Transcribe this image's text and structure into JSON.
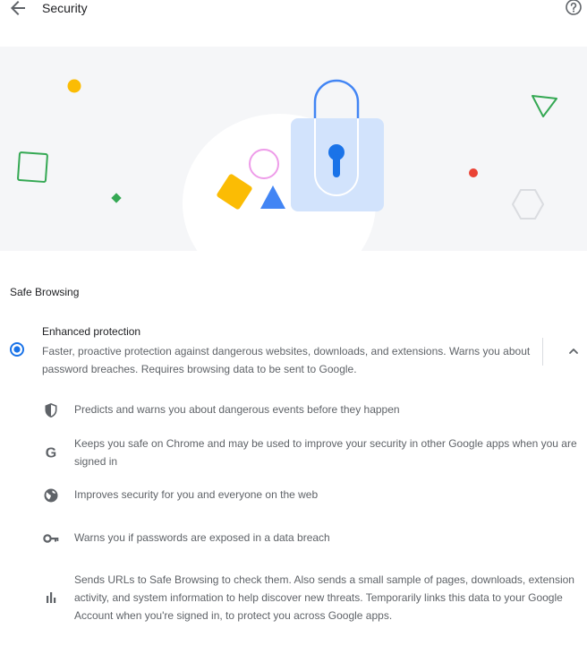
{
  "header": {
    "title": "Security"
  },
  "safe_browsing": {
    "section_title": "Safe Browsing",
    "enhanced": {
      "title": "Enhanced protection",
      "description": "Faster, proactive protection against dangerous websites, downloads, and extensions. Warns you about password breaches. Requires browsing data to be sent to Google.",
      "selected": true,
      "expanded": true,
      "features": [
        {
          "icon": "shield-icon",
          "text": "Predicts and warns you about dangerous events before they happen"
        },
        {
          "icon": "google-g-icon",
          "text": "Keeps you safe on Chrome and may be used to improve your security in other Google apps when you are signed in"
        },
        {
          "icon": "globe-icon",
          "text": "Improves security for you and everyone on the web"
        },
        {
          "icon": "key-icon",
          "text": "Warns you if passwords are exposed in a data breach"
        },
        {
          "icon": "bar-chart-icon",
          "text": "Sends URLs to Safe Browsing to check them. Also sends a small sample of pages, downloads, extension activity, and system information to help discover new threats. Temporarily links this data to your Google Account when you're signed in, to protect you across Google apps."
        }
      ]
    }
  },
  "colors": {
    "accent": "#1a73e8",
    "banner_bg": "#f5f6f8",
    "text_primary": "#202124",
    "text_secondary": "#5f6368"
  },
  "icons": {
    "back": "arrow-back-icon",
    "help": "help-circle-icon",
    "expand": "chevron-up-icon"
  }
}
